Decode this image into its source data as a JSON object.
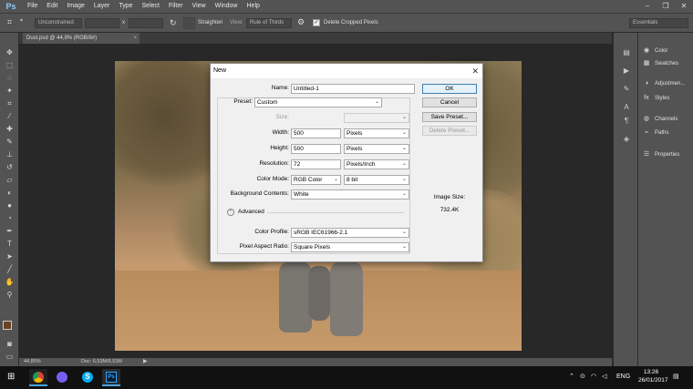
{
  "app": {
    "logo": "Ps"
  },
  "menu": [
    "File",
    "Edit",
    "Image",
    "Layer",
    "Type",
    "Select",
    "Filter",
    "View",
    "Window",
    "Help"
  ],
  "options_bar": {
    "ratio": "Unconstrained",
    "x_sep": "x",
    "straighten": "Straighten",
    "view_label": "View:",
    "view_value": "Rule of Thirds",
    "delete_cropped": "Delete Cropped Pixels",
    "workspace": "Essentials"
  },
  "document_tab": "Dust.psd @ 44,9% (RGB/8#)",
  "status": {
    "zoom": "44,85%",
    "doc": "Doc: 6,53M/6,53M"
  },
  "panels": [
    "Color",
    "Swatches",
    "Adjustmen...",
    "Styles",
    "Channels",
    "Paths",
    "Properties"
  ],
  "dialog": {
    "title": "New",
    "name_label": "Name:",
    "name_value": "Untitled-1",
    "preset_label": "Preset:",
    "preset_value": "Custom",
    "size_label": "Size:",
    "width_label": "Width:",
    "width_value": "500",
    "width_unit": "Pixels",
    "height_label": "Height:",
    "height_value": "500",
    "height_unit": "Pixels",
    "resolution_label": "Resolution:",
    "resolution_value": "72",
    "resolution_unit": "Pixels/Inch",
    "color_mode_label": "Color Mode:",
    "color_mode_value": "RGB Color",
    "bit_depth": "8 bit",
    "bg_label": "Background Contents:",
    "bg_value": "White",
    "advanced_label": "Advanced",
    "profile_label": "Color Profile:",
    "profile_value": "sRGB IEC61966-2.1",
    "aspect_label": "Pixel Aspect Ratio:",
    "aspect_value": "Square Pixels",
    "ok": "OK",
    "cancel": "Cancel",
    "save_preset": "Save Preset...",
    "delete_preset": "Delete Preset...",
    "image_size_label": "Image Size:",
    "image_size_value": "732.4K"
  },
  "taskbar": {
    "lang": "ENG",
    "time": "13:26",
    "date": "26/01/2017"
  }
}
